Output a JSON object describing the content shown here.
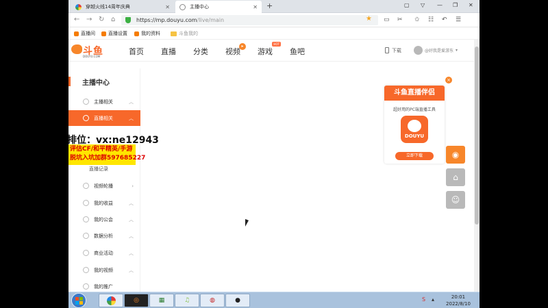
{
  "browser": {
    "tabs": [
      {
        "label": "穿越火线14周年庆典"
      },
      {
        "label": "主播中心"
      }
    ],
    "url_host": "https://mp.douyu.com",
    "url_path": "/live/main",
    "bookmarks": [
      {
        "label": "直播间"
      },
      {
        "label": "直播设置"
      },
      {
        "label": "我的资料"
      },
      {
        "label": "斗鱼我的"
      }
    ]
  },
  "site": {
    "logo_text": "斗鱼",
    "logo_sub": "DOUYU.COM",
    "nav": [
      {
        "label": "首页"
      },
      {
        "label": "直播"
      },
      {
        "label": "分类"
      },
      {
        "label": "视频"
      },
      {
        "label": "游戏"
      },
      {
        "label": "鱼吧"
      }
    ],
    "hot_badge": "HOT",
    "download": "下载",
    "user_name": "@好我是爱游东"
  },
  "sidebar": {
    "title": "主播中心",
    "items": [
      {
        "label": "主播相关"
      },
      {
        "label": "直播相关"
      },
      {
        "label": "直播记录"
      },
      {
        "label": "视频轮播"
      },
      {
        "label": "我的收益"
      },
      {
        "label": "我的公会"
      },
      {
        "label": "数据分析"
      },
      {
        "label": "商业活动"
      },
      {
        "label": "我的视频"
      },
      {
        "label": "我的推广"
      }
    ]
  },
  "overlay": {
    "line1": "排位：vx:ne12943",
    "line2": "评估CF/和平精英/手游",
    "line3": "脱坑入坑加群597685227"
  },
  "ad": {
    "title": "斗鱼直播伴侣",
    "subtitle": "超好用的PC端直播工具",
    "icon_text": "DOUYU",
    "button": "立即下载",
    "close": "×"
  },
  "taskbar": {
    "time": "20:01",
    "date": "2022/8/10"
  },
  "colors": {
    "brand": "#f7682a",
    "taskbar": "#a9c2dd"
  }
}
